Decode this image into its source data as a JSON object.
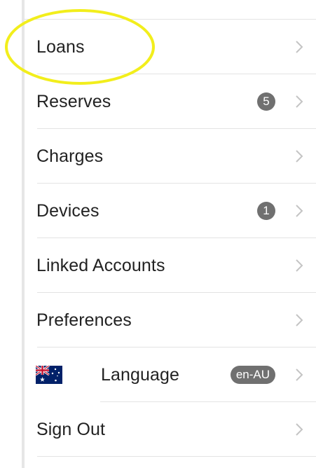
{
  "menu": {
    "loans": {
      "label": "Loans"
    },
    "reserves": {
      "label": "Reserves",
      "badge": "5"
    },
    "charges": {
      "label": "Charges"
    },
    "devices": {
      "label": "Devices",
      "badge": "1"
    },
    "linked_accounts": {
      "label": "Linked Accounts"
    },
    "preferences": {
      "label": "Preferences"
    },
    "language": {
      "label": "Language",
      "badge": "en-AU",
      "flag_icon": "australia-flag-icon"
    },
    "sign_out": {
      "label": "Sign Out"
    }
  },
  "colors": {
    "highlight": "#f2ee1c",
    "badge": "#707070",
    "chevron": "#c4c4c4",
    "divider": "#e3e3e3"
  },
  "icons": {
    "chevron": "chevron-right-icon",
    "highlight": "highlight-circle-annotation"
  }
}
